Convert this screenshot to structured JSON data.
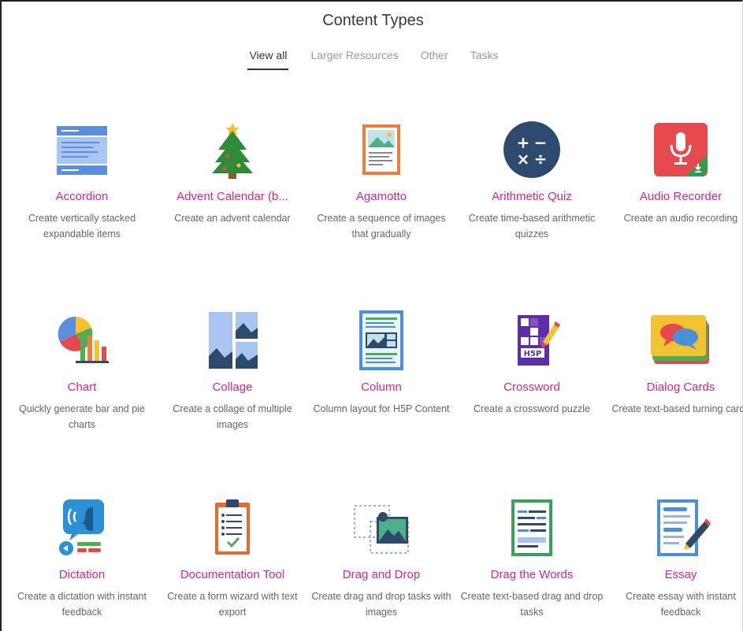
{
  "header": {
    "title": "Content Types"
  },
  "tabs": [
    {
      "label": "View all"
    },
    {
      "label": "Larger Resources"
    },
    {
      "label": "Other"
    },
    {
      "label": "Tasks"
    }
  ],
  "items": [
    {
      "name": "Accordion",
      "desc": "Create vertically stacked expandable items",
      "icon": "accordion-icon"
    },
    {
      "name": "Advent Calendar (b...",
      "desc": "Create an advent calendar",
      "icon": "christmas-tree-icon"
    },
    {
      "name": "Agamotto",
      "desc": "Create a sequence of images that gradually",
      "icon": "picture-sequence-icon"
    },
    {
      "name": "Arithmetic Quiz",
      "desc": "Create time-based arithmetic quizzes",
      "icon": "arithmetic-icon"
    },
    {
      "name": "Audio Recorder",
      "desc": "Create an audio recording",
      "icon": "microphone-icon"
    },
    {
      "name": "Chart",
      "desc": "Quickly generate bar and pie charts",
      "icon": "chart-icon"
    },
    {
      "name": "Collage",
      "desc": "Create a collage of multiple images",
      "icon": "collage-icon"
    },
    {
      "name": "Column",
      "desc": "Column layout for H5P Content",
      "icon": "column-layout-icon"
    },
    {
      "name": "Crossword",
      "desc": "Create a crossword puzzle",
      "icon": "crossword-icon"
    },
    {
      "name": "Dialog Cards",
      "desc": "Create text-based turning cards",
      "icon": "dialog-cards-icon"
    },
    {
      "name": "Dictation",
      "desc": "Create a dictation with instant feedback",
      "icon": "dictation-icon"
    },
    {
      "name": "Documentation Tool",
      "desc": "Create a form wizard with text export",
      "icon": "clipboard-icon"
    },
    {
      "name": "Drag and Drop",
      "desc": "Create drag and drop tasks with images",
      "icon": "drag-drop-icon"
    },
    {
      "name": "Drag the Words",
      "desc": "Create text-based drag and drop tasks",
      "icon": "drag-words-icon"
    },
    {
      "name": "Essay",
      "desc": "Create essay with instant feedback",
      "icon": "essay-icon"
    }
  ]
}
